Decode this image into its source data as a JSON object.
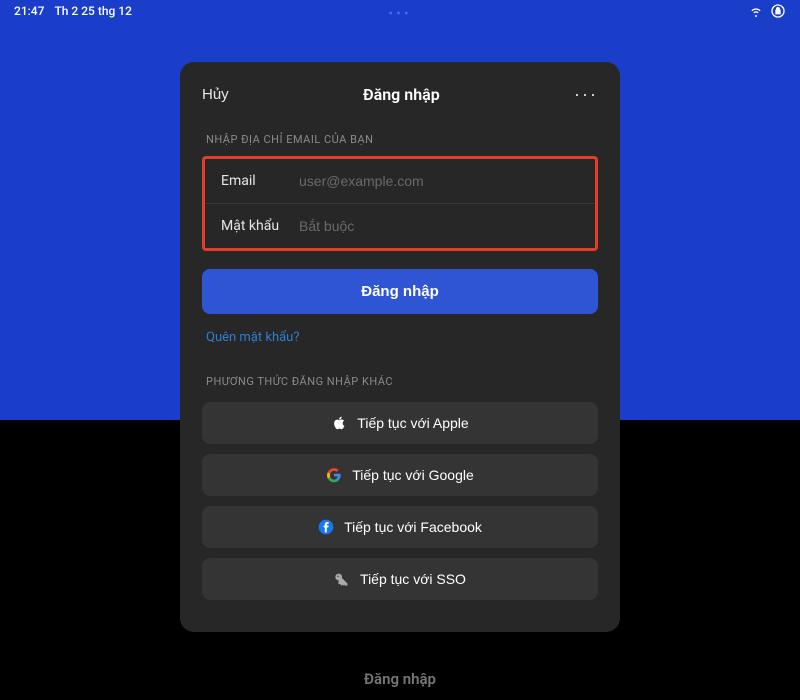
{
  "status_bar": {
    "time": "21:47",
    "date": "Th 2 25 thg 12"
  },
  "modal": {
    "header": {
      "cancel": "Hủy",
      "title": "Đăng nhập",
      "more": "···"
    },
    "email_section_label": "NHẬP ĐỊA CHỈ EMAIL CỦA BẠN",
    "fields": {
      "email_label": "Email",
      "email_placeholder": "user@example.com",
      "password_label": "Mật khẩu",
      "password_placeholder": "Bắt buộc"
    },
    "primary_action": "Đăng nhập",
    "forgot": "Quên mật khẩu?",
    "alt_section_label": "PHƯƠNG THỨC ĐĂNG NHẬP KHÁC",
    "social": {
      "apple": "Tiếp tục với Apple",
      "google": "Tiếp tục với Google",
      "facebook": "Tiếp tục với Facebook",
      "sso": "Tiếp tục với SSO"
    }
  },
  "below_login": "Đăng nhập"
}
